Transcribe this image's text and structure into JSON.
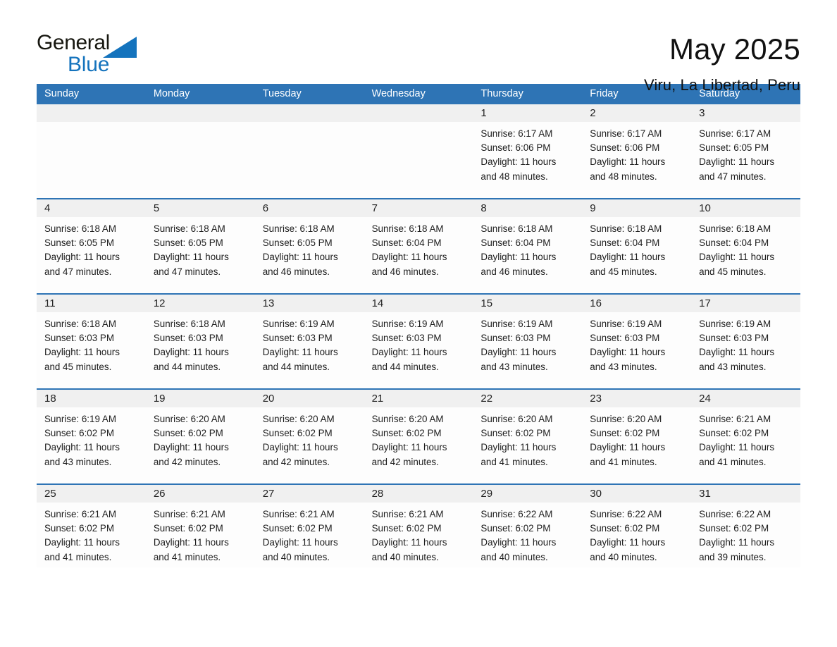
{
  "brand": {
    "name_part1": "General",
    "name_part2": "Blue",
    "color_dark": "#16160f",
    "color_blue": "#1473bd"
  },
  "header": {
    "title": "May 2025",
    "subtitle": "Viru, La Libertad, Peru"
  },
  "theme": {
    "header_blue": "#2e74b5",
    "day_band_gray": "#f0f0f0",
    "page_background": "#ffffff"
  },
  "weekdays": [
    "Sunday",
    "Monday",
    "Tuesday",
    "Wednesday",
    "Thursday",
    "Friday",
    "Saturday"
  ],
  "weeks": [
    [
      {
        "day": "",
        "lines": []
      },
      {
        "day": "",
        "lines": []
      },
      {
        "day": "",
        "lines": []
      },
      {
        "day": "",
        "lines": []
      },
      {
        "day": "1",
        "lines": [
          "Sunrise: 6:17 AM",
          "Sunset: 6:06 PM",
          "Daylight: 11 hours",
          "and 48 minutes."
        ]
      },
      {
        "day": "2",
        "lines": [
          "Sunrise: 6:17 AM",
          "Sunset: 6:06 PM",
          "Daylight: 11 hours",
          "and 48 minutes."
        ]
      },
      {
        "day": "3",
        "lines": [
          "Sunrise: 6:17 AM",
          "Sunset: 6:05 PM",
          "Daylight: 11 hours",
          "and 47 minutes."
        ]
      }
    ],
    [
      {
        "day": "4",
        "lines": [
          "Sunrise: 6:18 AM",
          "Sunset: 6:05 PM",
          "Daylight: 11 hours",
          "and 47 minutes."
        ]
      },
      {
        "day": "5",
        "lines": [
          "Sunrise: 6:18 AM",
          "Sunset: 6:05 PM",
          "Daylight: 11 hours",
          "and 47 minutes."
        ]
      },
      {
        "day": "6",
        "lines": [
          "Sunrise: 6:18 AM",
          "Sunset: 6:05 PM",
          "Daylight: 11 hours",
          "and 46 minutes."
        ]
      },
      {
        "day": "7",
        "lines": [
          "Sunrise: 6:18 AM",
          "Sunset: 6:04 PM",
          "Daylight: 11 hours",
          "and 46 minutes."
        ]
      },
      {
        "day": "8",
        "lines": [
          "Sunrise: 6:18 AM",
          "Sunset: 6:04 PM",
          "Daylight: 11 hours",
          "and 46 minutes."
        ]
      },
      {
        "day": "9",
        "lines": [
          "Sunrise: 6:18 AM",
          "Sunset: 6:04 PM",
          "Daylight: 11 hours",
          "and 45 minutes."
        ]
      },
      {
        "day": "10",
        "lines": [
          "Sunrise: 6:18 AM",
          "Sunset: 6:04 PM",
          "Daylight: 11 hours",
          "and 45 minutes."
        ]
      }
    ],
    [
      {
        "day": "11",
        "lines": [
          "Sunrise: 6:18 AM",
          "Sunset: 6:03 PM",
          "Daylight: 11 hours",
          "and 45 minutes."
        ]
      },
      {
        "day": "12",
        "lines": [
          "Sunrise: 6:18 AM",
          "Sunset: 6:03 PM",
          "Daylight: 11 hours",
          "and 44 minutes."
        ]
      },
      {
        "day": "13",
        "lines": [
          "Sunrise: 6:19 AM",
          "Sunset: 6:03 PM",
          "Daylight: 11 hours",
          "and 44 minutes."
        ]
      },
      {
        "day": "14",
        "lines": [
          "Sunrise: 6:19 AM",
          "Sunset: 6:03 PM",
          "Daylight: 11 hours",
          "and 44 minutes."
        ]
      },
      {
        "day": "15",
        "lines": [
          "Sunrise: 6:19 AM",
          "Sunset: 6:03 PM",
          "Daylight: 11 hours",
          "and 43 minutes."
        ]
      },
      {
        "day": "16",
        "lines": [
          "Sunrise: 6:19 AM",
          "Sunset: 6:03 PM",
          "Daylight: 11 hours",
          "and 43 minutes."
        ]
      },
      {
        "day": "17",
        "lines": [
          "Sunrise: 6:19 AM",
          "Sunset: 6:03 PM",
          "Daylight: 11 hours",
          "and 43 minutes."
        ]
      }
    ],
    [
      {
        "day": "18",
        "lines": [
          "Sunrise: 6:19 AM",
          "Sunset: 6:02 PM",
          "Daylight: 11 hours",
          "and 43 minutes."
        ]
      },
      {
        "day": "19",
        "lines": [
          "Sunrise: 6:20 AM",
          "Sunset: 6:02 PM",
          "Daylight: 11 hours",
          "and 42 minutes."
        ]
      },
      {
        "day": "20",
        "lines": [
          "Sunrise: 6:20 AM",
          "Sunset: 6:02 PM",
          "Daylight: 11 hours",
          "and 42 minutes."
        ]
      },
      {
        "day": "21",
        "lines": [
          "Sunrise: 6:20 AM",
          "Sunset: 6:02 PM",
          "Daylight: 11 hours",
          "and 42 minutes."
        ]
      },
      {
        "day": "22",
        "lines": [
          "Sunrise: 6:20 AM",
          "Sunset: 6:02 PM",
          "Daylight: 11 hours",
          "and 41 minutes."
        ]
      },
      {
        "day": "23",
        "lines": [
          "Sunrise: 6:20 AM",
          "Sunset: 6:02 PM",
          "Daylight: 11 hours",
          "and 41 minutes."
        ]
      },
      {
        "day": "24",
        "lines": [
          "Sunrise: 6:21 AM",
          "Sunset: 6:02 PM",
          "Daylight: 11 hours",
          "and 41 minutes."
        ]
      }
    ],
    [
      {
        "day": "25",
        "lines": [
          "Sunrise: 6:21 AM",
          "Sunset: 6:02 PM",
          "Daylight: 11 hours",
          "and 41 minutes."
        ]
      },
      {
        "day": "26",
        "lines": [
          "Sunrise: 6:21 AM",
          "Sunset: 6:02 PM",
          "Daylight: 11 hours",
          "and 41 minutes."
        ]
      },
      {
        "day": "27",
        "lines": [
          "Sunrise: 6:21 AM",
          "Sunset: 6:02 PM",
          "Daylight: 11 hours",
          "and 40 minutes."
        ]
      },
      {
        "day": "28",
        "lines": [
          "Sunrise: 6:21 AM",
          "Sunset: 6:02 PM",
          "Daylight: 11 hours",
          "and 40 minutes."
        ]
      },
      {
        "day": "29",
        "lines": [
          "Sunrise: 6:22 AM",
          "Sunset: 6:02 PM",
          "Daylight: 11 hours",
          "and 40 minutes."
        ]
      },
      {
        "day": "30",
        "lines": [
          "Sunrise: 6:22 AM",
          "Sunset: 6:02 PM",
          "Daylight: 11 hours",
          "and 40 minutes."
        ]
      },
      {
        "day": "31",
        "lines": [
          "Sunrise: 6:22 AM",
          "Sunset: 6:02 PM",
          "Daylight: 11 hours",
          "and 39 minutes."
        ]
      }
    ]
  ]
}
